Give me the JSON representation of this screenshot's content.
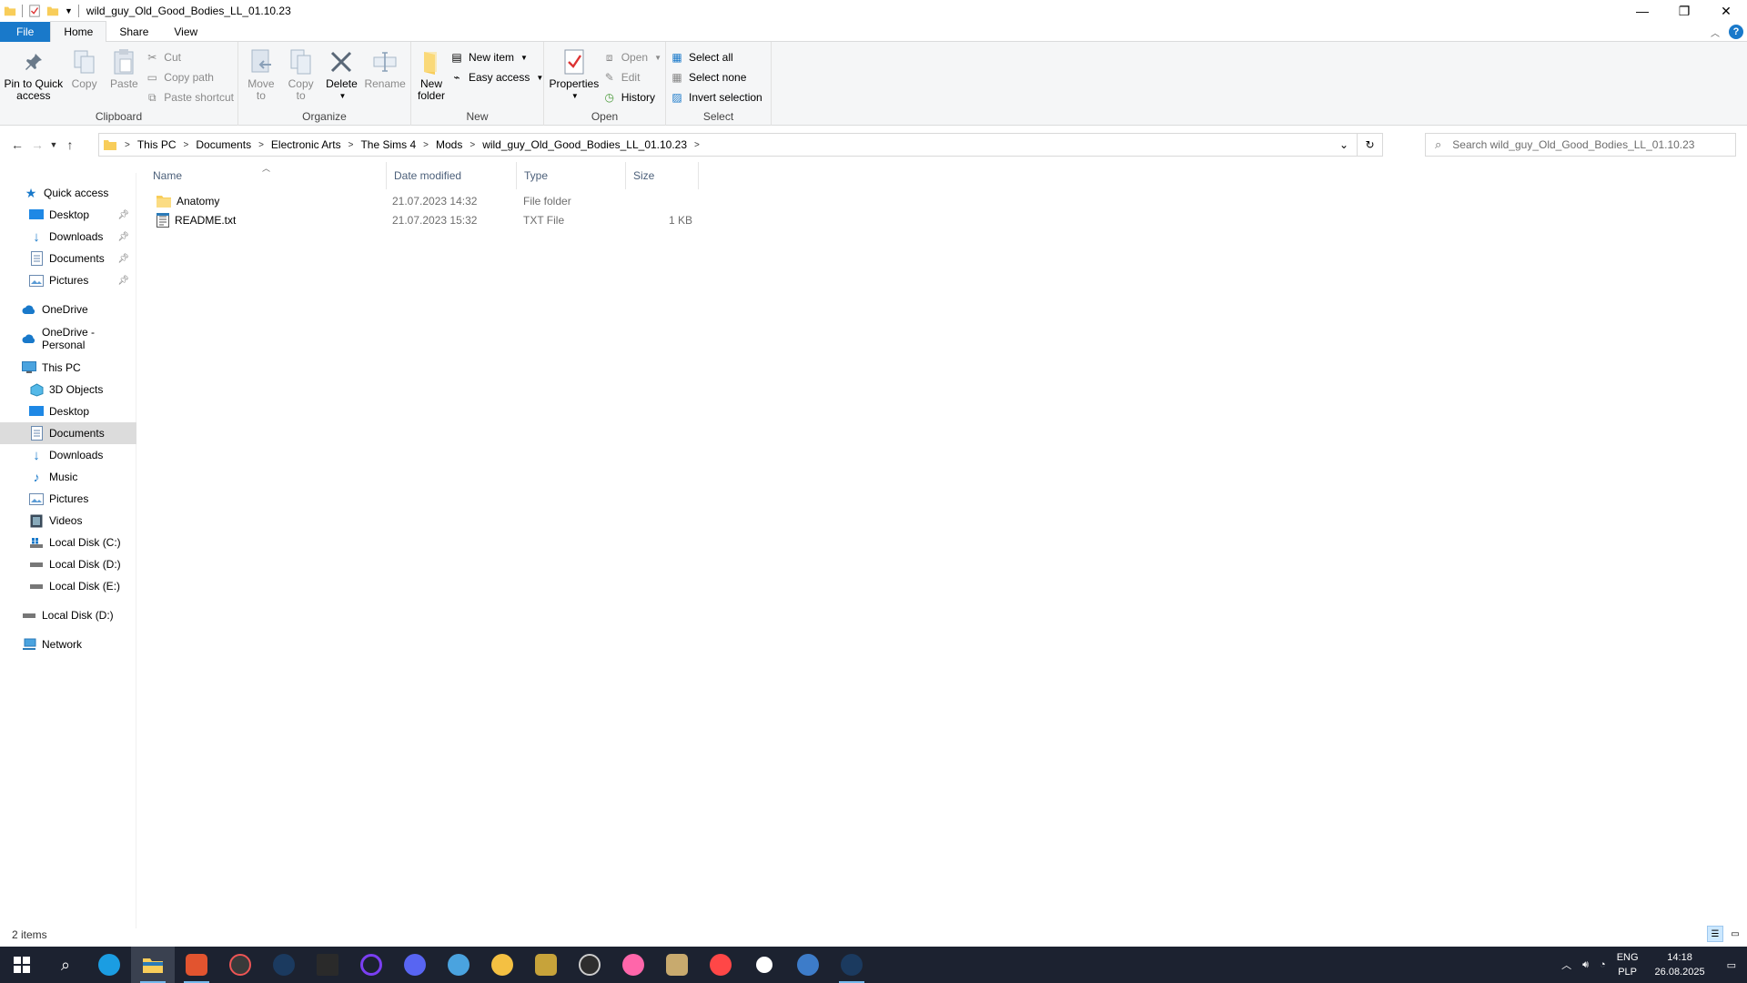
{
  "window": {
    "title": "wild_guy_Old_Good_Bodies_LL_01.10.23"
  },
  "ribbon_tabs": [
    "File",
    "Home",
    "Share",
    "View"
  ],
  "ribbon": {
    "clipboard": {
      "label": "Clipboard",
      "pin": "Pin to Quick access",
      "copy": "Copy",
      "paste": "Paste",
      "cut": "Cut",
      "copy_path": "Copy path",
      "paste_shortcut": "Paste shortcut"
    },
    "organize": {
      "label": "Organize",
      "move_to": "Move to",
      "copy_to": "Copy to",
      "delete": "Delete",
      "rename": "Rename"
    },
    "new": {
      "label": "New",
      "new_folder": "New folder",
      "new_item": "New item",
      "easy_access": "Easy access"
    },
    "open": {
      "label": "Open",
      "properties": "Properties",
      "open": "Open",
      "edit": "Edit",
      "history": "History"
    },
    "select": {
      "label": "Select",
      "select_all": "Select all",
      "select_none": "Select none",
      "invert": "Invert selection"
    }
  },
  "address": {
    "crumbs": [
      "This PC",
      "Documents",
      "Electronic Arts",
      "The Sims 4",
      "Mods",
      "wild_guy_Old_Good_Bodies_LL_01.10.23"
    ]
  },
  "search": {
    "placeholder": "Search wild_guy_Old_Good_Bodies_LL_01.10.23"
  },
  "nav": {
    "quick_access": "Quick access",
    "qa_desktop": "Desktop",
    "qa_downloads": "Downloads",
    "qa_documents": "Documents",
    "qa_pictures": "Pictures",
    "onedrive": "OneDrive",
    "onedrive_personal": "OneDrive - Personal",
    "this_pc": "This PC",
    "objects3d": "3D Objects",
    "desktop": "Desktop",
    "documents": "Documents",
    "downloads": "Downloads",
    "music": "Music",
    "pictures": "Pictures",
    "videos": "Videos",
    "disk_c": "Local Disk (C:)",
    "disk_d": "Local Disk (D:)",
    "disk_e": "Local Disk (E:)",
    "disk_d2": "Local Disk (D:)",
    "network": "Network"
  },
  "columns": {
    "name": "Name",
    "date": "Date modified",
    "type": "Type",
    "size": "Size"
  },
  "files": [
    {
      "name": "Anatomy",
      "date": "21.07.2023 14:32",
      "type": "File folder",
      "size": ""
    },
    {
      "name": "README.txt",
      "date": "21.07.2023 15:32",
      "type": "TXT File",
      "size": "1 KB"
    }
  ],
  "status": {
    "count": "2 items"
  },
  "tray": {
    "lang1": "ENG",
    "lang2": "PLP",
    "time": "14:18",
    "date": "26.08.2025"
  },
  "colors": {
    "accent": "#1979ca",
    "taskbar": "#1c2230",
    "folder": "#f8cd5a"
  }
}
